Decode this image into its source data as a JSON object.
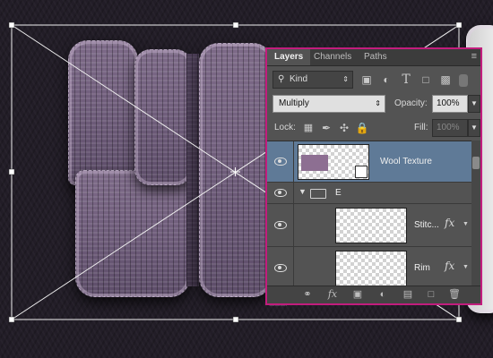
{
  "panel": {
    "tabs": [
      {
        "label": "Layers",
        "active": true
      },
      {
        "label": "Channels",
        "active": false
      },
      {
        "label": "Paths",
        "active": false
      }
    ],
    "filter": {
      "kind_label": "Kind"
    },
    "blend_mode": "Multiply",
    "opacity": {
      "label": "Opacity:",
      "value": "100%"
    },
    "lock": {
      "label": "Lock:"
    },
    "fill": {
      "label": "Fill:",
      "value": "100%"
    },
    "layers": [
      {
        "name": "Wool Texture",
        "selected": true,
        "type": "smart-object"
      },
      {
        "name": "E",
        "selected": false,
        "type": "group",
        "expanded": true
      },
      {
        "name": "Stitc...",
        "selected": false,
        "type": "layer",
        "has_fx": true
      },
      {
        "name": "Rim",
        "selected": false,
        "type": "layer",
        "has_fx": true
      }
    ],
    "fx_label": "fx"
  },
  "colors": {
    "panel_border": "#c21d7d",
    "selected_layer": "#5f7a97",
    "wool": "#7d6a88"
  }
}
